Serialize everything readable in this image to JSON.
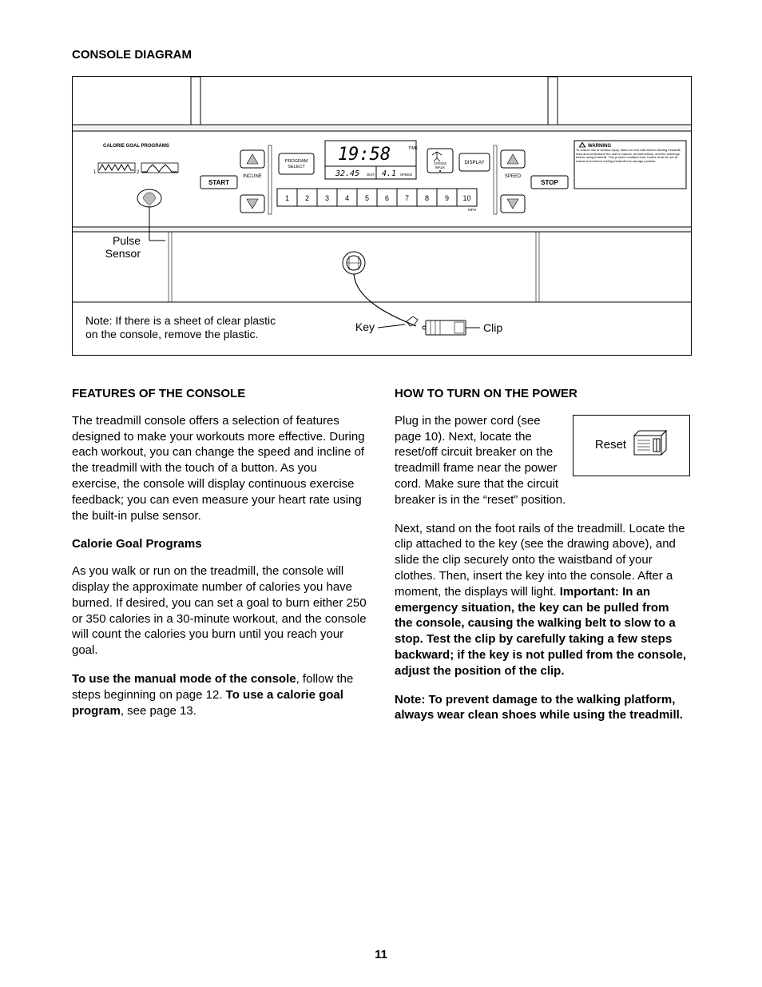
{
  "page_number": "11",
  "heading_diagram": "CONSOLE DIAGRAM",
  "diagram": {
    "calorie_goal_title": "CALORIE GOAL PROGRAMS",
    "program_select": "PROGRAM\nSELECT",
    "start": "START",
    "incline": "INCLINE",
    "speed": "SPEED",
    "stop": "STOP",
    "crosswalk": "CROSS\nWALK",
    "display": "DISPLAY",
    "warning_title": "WARNING",
    "warning_body": "To reduce risk of serious injury, stand on foot rails before starting treadmill, read and understand the user's manual, all instructions, and the warnings before using treadmill. This product contains lead. Incline must be set at lowest level before folding treadmill into storage position.",
    "time_label": "TIME",
    "display_big": "19:58",
    "display_dist": "32.45",
    "dist_label": "DIST.",
    "display_speed": "4.1",
    "speed_label": "SPEED",
    "mph": "MPH",
    "numbers": [
      "1",
      "2",
      "3",
      "4",
      "5",
      "6",
      "7",
      "8",
      "9",
      "10"
    ],
    "pulse_sensor": "Pulse\nSensor",
    "note": "Note: If there is a sheet of clear plastic on the console, remove the plastic.",
    "key": "Key",
    "clip": "Clip",
    "profile_1": "1",
    "profile_2": "2"
  },
  "left": {
    "title": "FEATURES OF THE CONSOLE",
    "p1": "The treadmill console offers a selection of features designed to make your workouts more effective. During each workout, you can change the speed and incline of the treadmill with the touch of a button. As you exercise, the console will display continuous exercise feedback; you can even measure your heart rate using the built-in pulse sensor.",
    "sub1": "Calorie Goal Programs",
    "p2": "As you walk or run on the treadmill, the console will display the approximate number of calories you have burned. If desired, you can set a goal to burn either 250 or 350 calories in a 30-minute workout, and the console will count the calories you burn until you reach your goal.",
    "p3a": "To use the manual mode of the console",
    "p3b": ", follow the steps beginning on page 12. ",
    "p3c": "To use a calorie goal program",
    "p3d": ", see page 13."
  },
  "right": {
    "title": "HOW TO TURN ON THE POWER",
    "reset_label": "Reset",
    "p1": "Plug in the power cord (see page 10). Next, locate the reset/off circuit breaker on the treadmill frame near the power cord. Make sure that the circuit breaker is in the “reset” position.",
    "p2a": "Next, stand on the foot rails of the treadmill. Locate the clip attached to the key (see the drawing above), and slide the clip securely onto the waistband of your clothes. Then, insert the key into the console. After a moment, the displays will light. ",
    "p2b": "Important: In an emergency situation, the key can be pulled from the console, causing the walking belt to slow to a stop. Test the clip by carefully taking a few steps backward; if the key is not pulled from the console, adjust the position of the clip.",
    "p3": "Note: To prevent damage to the walking platform, always wear clean shoes while using the treadmill."
  }
}
